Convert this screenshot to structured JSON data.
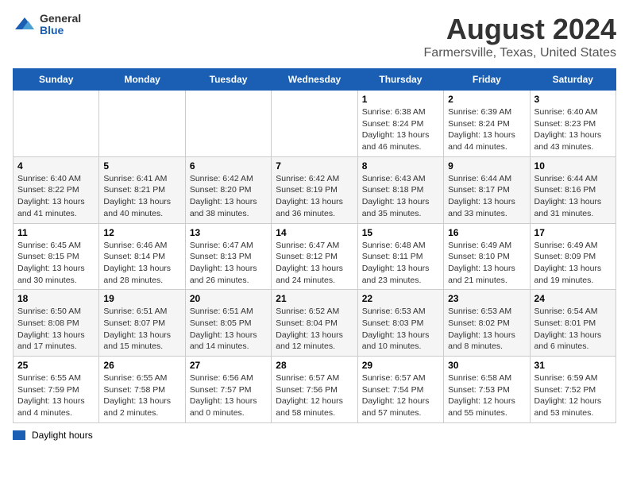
{
  "header": {
    "logo_general": "General",
    "logo_blue": "Blue",
    "month_year": "August 2024",
    "location": "Farmersville, Texas, United States"
  },
  "days_of_week": [
    "Sunday",
    "Monday",
    "Tuesday",
    "Wednesday",
    "Thursday",
    "Friday",
    "Saturday"
  ],
  "weeks": [
    [
      {
        "day": "",
        "info": ""
      },
      {
        "day": "",
        "info": ""
      },
      {
        "day": "",
        "info": ""
      },
      {
        "day": "",
        "info": ""
      },
      {
        "day": "1",
        "info": "Sunrise: 6:38 AM\nSunset: 8:24 PM\nDaylight: 13 hours\nand 46 minutes."
      },
      {
        "day": "2",
        "info": "Sunrise: 6:39 AM\nSunset: 8:24 PM\nDaylight: 13 hours\nand 44 minutes."
      },
      {
        "day": "3",
        "info": "Sunrise: 6:40 AM\nSunset: 8:23 PM\nDaylight: 13 hours\nand 43 minutes."
      }
    ],
    [
      {
        "day": "4",
        "info": "Sunrise: 6:40 AM\nSunset: 8:22 PM\nDaylight: 13 hours\nand 41 minutes."
      },
      {
        "day": "5",
        "info": "Sunrise: 6:41 AM\nSunset: 8:21 PM\nDaylight: 13 hours\nand 40 minutes."
      },
      {
        "day": "6",
        "info": "Sunrise: 6:42 AM\nSunset: 8:20 PM\nDaylight: 13 hours\nand 38 minutes."
      },
      {
        "day": "7",
        "info": "Sunrise: 6:42 AM\nSunset: 8:19 PM\nDaylight: 13 hours\nand 36 minutes."
      },
      {
        "day": "8",
        "info": "Sunrise: 6:43 AM\nSunset: 8:18 PM\nDaylight: 13 hours\nand 35 minutes."
      },
      {
        "day": "9",
        "info": "Sunrise: 6:44 AM\nSunset: 8:17 PM\nDaylight: 13 hours\nand 33 minutes."
      },
      {
        "day": "10",
        "info": "Sunrise: 6:44 AM\nSunset: 8:16 PM\nDaylight: 13 hours\nand 31 minutes."
      }
    ],
    [
      {
        "day": "11",
        "info": "Sunrise: 6:45 AM\nSunset: 8:15 PM\nDaylight: 13 hours\nand 30 minutes."
      },
      {
        "day": "12",
        "info": "Sunrise: 6:46 AM\nSunset: 8:14 PM\nDaylight: 13 hours\nand 28 minutes."
      },
      {
        "day": "13",
        "info": "Sunrise: 6:47 AM\nSunset: 8:13 PM\nDaylight: 13 hours\nand 26 minutes."
      },
      {
        "day": "14",
        "info": "Sunrise: 6:47 AM\nSunset: 8:12 PM\nDaylight: 13 hours\nand 24 minutes."
      },
      {
        "day": "15",
        "info": "Sunrise: 6:48 AM\nSunset: 8:11 PM\nDaylight: 13 hours\nand 23 minutes."
      },
      {
        "day": "16",
        "info": "Sunrise: 6:49 AM\nSunset: 8:10 PM\nDaylight: 13 hours\nand 21 minutes."
      },
      {
        "day": "17",
        "info": "Sunrise: 6:49 AM\nSunset: 8:09 PM\nDaylight: 13 hours\nand 19 minutes."
      }
    ],
    [
      {
        "day": "18",
        "info": "Sunrise: 6:50 AM\nSunset: 8:08 PM\nDaylight: 13 hours\nand 17 minutes."
      },
      {
        "day": "19",
        "info": "Sunrise: 6:51 AM\nSunset: 8:07 PM\nDaylight: 13 hours\nand 15 minutes."
      },
      {
        "day": "20",
        "info": "Sunrise: 6:51 AM\nSunset: 8:05 PM\nDaylight: 13 hours\nand 14 minutes."
      },
      {
        "day": "21",
        "info": "Sunrise: 6:52 AM\nSunset: 8:04 PM\nDaylight: 13 hours\nand 12 minutes."
      },
      {
        "day": "22",
        "info": "Sunrise: 6:53 AM\nSunset: 8:03 PM\nDaylight: 13 hours\nand 10 minutes."
      },
      {
        "day": "23",
        "info": "Sunrise: 6:53 AM\nSunset: 8:02 PM\nDaylight: 13 hours\nand 8 minutes."
      },
      {
        "day": "24",
        "info": "Sunrise: 6:54 AM\nSunset: 8:01 PM\nDaylight: 13 hours\nand 6 minutes."
      }
    ],
    [
      {
        "day": "25",
        "info": "Sunrise: 6:55 AM\nSunset: 7:59 PM\nDaylight: 13 hours\nand 4 minutes."
      },
      {
        "day": "26",
        "info": "Sunrise: 6:55 AM\nSunset: 7:58 PM\nDaylight: 13 hours\nand 2 minutes."
      },
      {
        "day": "27",
        "info": "Sunrise: 6:56 AM\nSunset: 7:57 PM\nDaylight: 13 hours\nand 0 minutes."
      },
      {
        "day": "28",
        "info": "Sunrise: 6:57 AM\nSunset: 7:56 PM\nDaylight: 12 hours\nand 58 minutes."
      },
      {
        "day": "29",
        "info": "Sunrise: 6:57 AM\nSunset: 7:54 PM\nDaylight: 12 hours\nand 57 minutes."
      },
      {
        "day": "30",
        "info": "Sunrise: 6:58 AM\nSunset: 7:53 PM\nDaylight: 12 hours\nand 55 minutes."
      },
      {
        "day": "31",
        "info": "Sunrise: 6:59 AM\nSunset: 7:52 PM\nDaylight: 12 hours\nand 53 minutes."
      }
    ]
  ],
  "legend": {
    "label": "Daylight hours"
  }
}
